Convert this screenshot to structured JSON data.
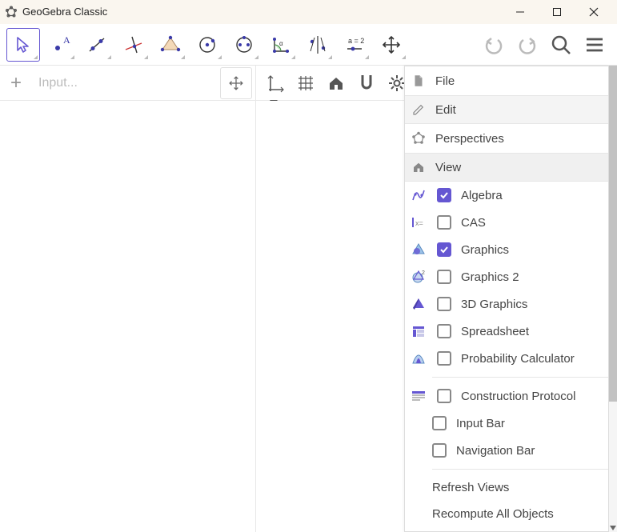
{
  "window": {
    "title": "GeoGebra Classic"
  },
  "toolbar": {
    "tools": [
      {
        "name": "move-tool",
        "selected": true
      },
      {
        "name": "point-tool"
      },
      {
        "name": "line-tool"
      },
      {
        "name": "perpendicular-tool"
      },
      {
        "name": "polygon-tool"
      },
      {
        "name": "circle-tool"
      },
      {
        "name": "ellipse-tool"
      },
      {
        "name": "angle-tool"
      },
      {
        "name": "reflect-tool"
      },
      {
        "name": "slider-tool"
      },
      {
        "name": "move-graphics-tool"
      }
    ]
  },
  "algebra": {
    "input_placeholder": "Input..."
  },
  "graphics_sub": {
    "items": [
      {
        "name": "axes-toggle"
      },
      {
        "name": "grid-toggle"
      },
      {
        "name": "home-view"
      },
      {
        "name": "snap-toggle"
      },
      {
        "name": "settings"
      }
    ]
  },
  "menu": {
    "file": "File",
    "edit": "Edit",
    "perspectives": "Perspectives",
    "view": "View",
    "views": [
      {
        "key": "algebra",
        "label": "Algebra",
        "checked": true
      },
      {
        "key": "cas",
        "label": "CAS",
        "checked": false
      },
      {
        "key": "graphics",
        "label": "Graphics",
        "checked": true
      },
      {
        "key": "graphics2",
        "label": "Graphics 2",
        "checked": false
      },
      {
        "key": "graphics3d",
        "label": "3D Graphics",
        "checked": false
      },
      {
        "key": "spreadsheet",
        "label": "Spreadsheet",
        "checked": false
      },
      {
        "key": "probability",
        "label": "Probability Calculator",
        "checked": false
      }
    ],
    "extras": [
      {
        "key": "construction",
        "label": "Construction Protocol",
        "checked": false,
        "hasicon": true
      },
      {
        "key": "inputbar",
        "label": "Input Bar",
        "checked": false,
        "hasicon": false
      },
      {
        "key": "navbar",
        "label": "Navigation Bar",
        "checked": false,
        "hasicon": false
      }
    ],
    "refresh": "Refresh Views",
    "recompute": "Recompute All Objects"
  },
  "colors": {
    "accent": "#6557d2"
  }
}
